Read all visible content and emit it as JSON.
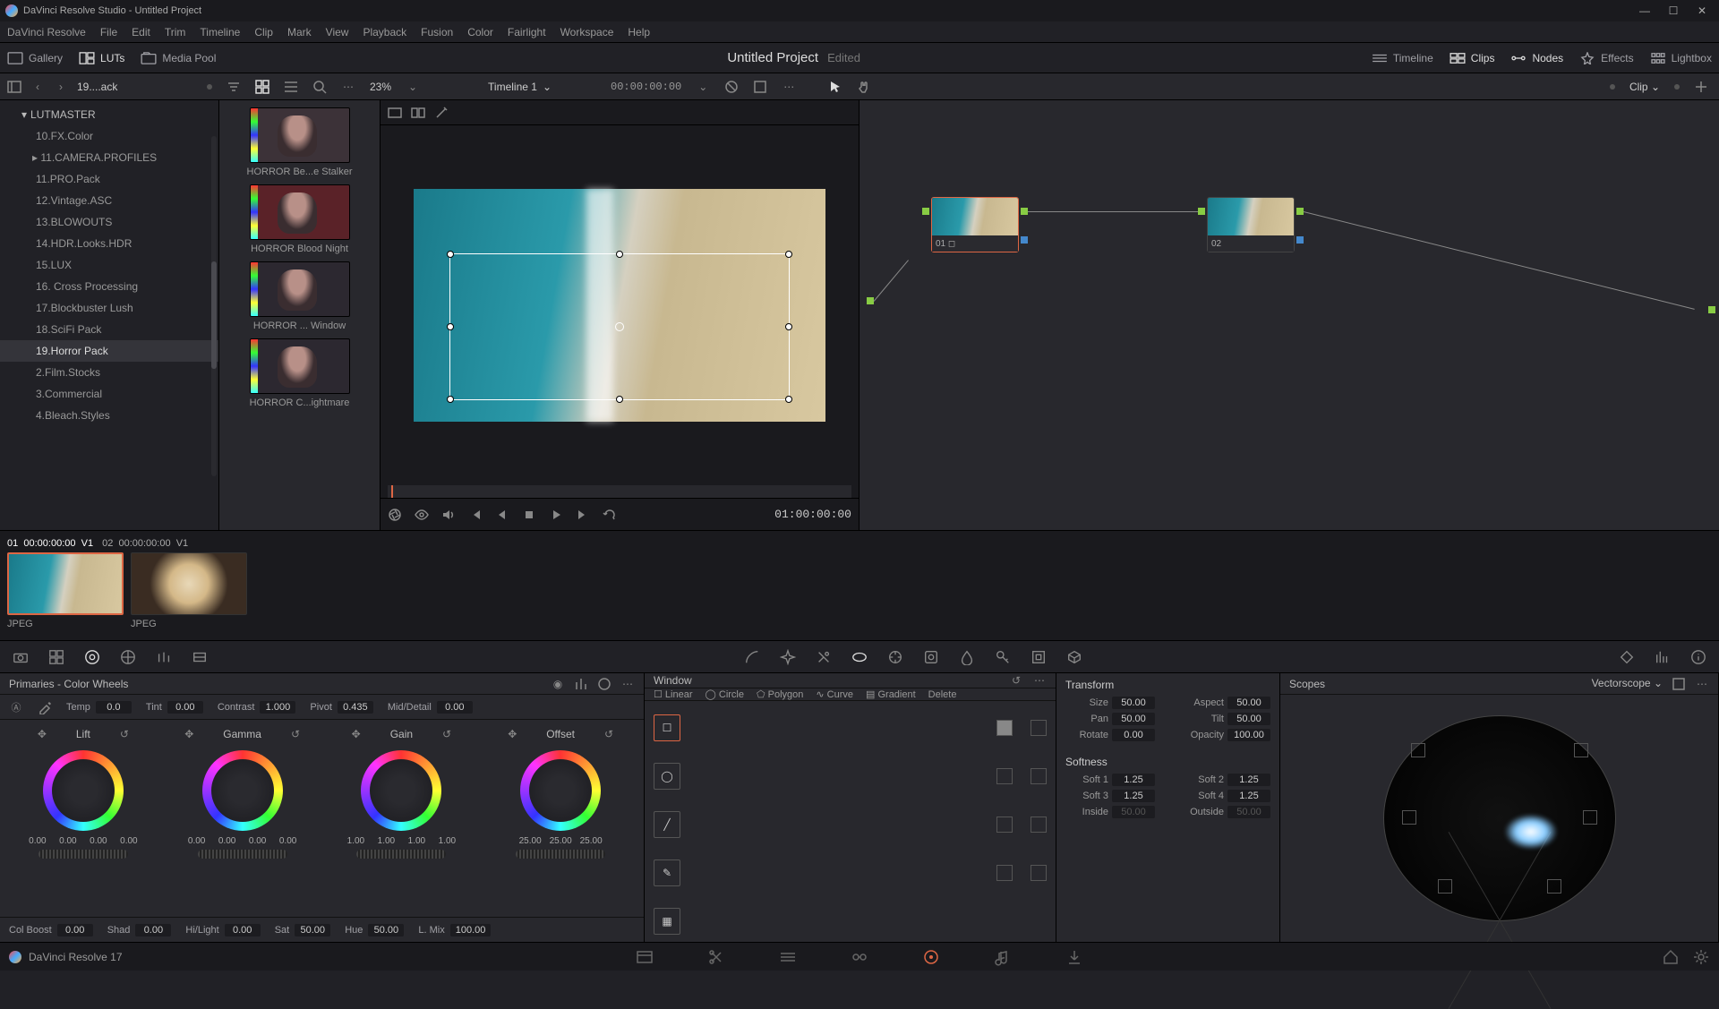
{
  "titlebar": {
    "text": "DaVinci Resolve Studio - Untitled Project"
  },
  "menubar": [
    "DaVinci Resolve",
    "File",
    "Edit",
    "Trim",
    "Timeline",
    "Clip",
    "Mark",
    "View",
    "Playback",
    "Fusion",
    "Color",
    "Fairlight",
    "Workspace",
    "Help"
  ],
  "topbar": {
    "left": [
      {
        "icon": "gallery-icon",
        "label": "Gallery"
      },
      {
        "icon": "luts-icon",
        "label": "LUTs"
      },
      {
        "icon": "mediapool-icon",
        "label": "Media Pool"
      }
    ],
    "center": {
      "title": "Untitled Project",
      "status": "Edited"
    },
    "right": [
      {
        "icon": "timeline-icon",
        "label": "Timeline"
      },
      {
        "icon": "clips-icon",
        "label": "Clips"
      },
      {
        "icon": "nodes-icon",
        "label": "Nodes"
      },
      {
        "icon": "effects-icon",
        "label": "Effects"
      },
      {
        "icon": "lightbox-icon",
        "label": "Lightbox"
      }
    ]
  },
  "subbar": {
    "breadcrumb": "19....ack",
    "zoom": "23%",
    "timeline": "Timeline 1",
    "timecode": "00:00:00:00",
    "clip_dd": "Clip"
  },
  "folders": {
    "root": "LUTMASTER",
    "items": [
      "10.FX.Color",
      "11.CAMERA.PROFILES",
      "11.PRO.Pack",
      "12.Vintage.ASC",
      "13.BLOWOUTS",
      "14.HDR.Looks.HDR",
      "15.LUX",
      "16. Cross Processing",
      "17.Blockbuster Lush",
      "18.SciFi Pack",
      "19.Horror Pack",
      "2.Film.Stocks",
      "3.Commercial",
      "4.Bleach.Styles"
    ],
    "expanded": 1,
    "selected": 10
  },
  "luts": [
    {
      "label": "HORROR Be...e Stalker",
      "tone": "red"
    },
    {
      "label": "HORROR Blood Night",
      "tone": "red"
    },
    {
      "label": "HORROR ... Window",
      "tone": "dark"
    },
    {
      "label": "HORROR C...ightmare",
      "tone": "dark"
    }
  ],
  "viewer": {
    "playhead_tc": "01:00:00:00"
  },
  "nodes": [
    {
      "id": "01",
      "selected": true
    },
    {
      "id": "02",
      "selected": false
    }
  ],
  "clips": {
    "hdr": [
      {
        "idx": "01",
        "tc": "00:00:00:00",
        "trk": "V1",
        "sel": true
      },
      {
        "idx": "02",
        "tc": "00:00:00:00",
        "trk": "V1",
        "sel": false
      }
    ],
    "labels": [
      "JPEG",
      "JPEG"
    ]
  },
  "primaries": {
    "title": "Primaries - Color Wheels",
    "adjust": {
      "temp_lbl": "Temp",
      "temp": "0.0",
      "tint_lbl": "Tint",
      "tint": "0.00",
      "contrast_lbl": "Contrast",
      "contrast": "1.000",
      "pivot_lbl": "Pivot",
      "pivot": "0.435",
      "mid_lbl": "Mid/Detail",
      "mid": "0.00"
    },
    "wheels": [
      {
        "name": "Lift",
        "vals": [
          "0.00",
          "0.00",
          "0.00",
          "0.00"
        ]
      },
      {
        "name": "Gamma",
        "vals": [
          "0.00",
          "0.00",
          "0.00",
          "0.00"
        ]
      },
      {
        "name": "Gain",
        "vals": [
          "1.00",
          "1.00",
          "1.00",
          "1.00"
        ]
      },
      {
        "name": "Offset",
        "vals": [
          "25.00",
          "25.00",
          "25.00"
        ]
      }
    ],
    "footer": {
      "cb_lbl": "Col Boost",
      "cb": "0.00",
      "shad_lbl": "Shad",
      "shad": "0.00",
      "hl_lbl": "Hi/Light",
      "hl": "0.00",
      "sat_lbl": "Sat",
      "sat": "50.00",
      "hue_lbl": "Hue",
      "hue": "50.00",
      "lmix_lbl": "L. Mix",
      "lmix": "100.00"
    }
  },
  "window": {
    "title": "Window",
    "tabs": [
      "Linear",
      "Circle",
      "Polygon",
      "Curve",
      "Gradient",
      "Delete"
    ]
  },
  "transform": {
    "t1": "Transform",
    "size_lbl": "Size",
    "size": "50.00",
    "aspect_lbl": "Aspect",
    "aspect": "50.00",
    "pan_lbl": "Pan",
    "pan": "50.00",
    "tilt_lbl": "Tilt",
    "tilt": "50.00",
    "rot_lbl": "Rotate",
    "rot": "0.00",
    "op_lbl": "Opacity",
    "op": "100.00",
    "t2": "Softness",
    "s1_lbl": "Soft 1",
    "s1": "1.25",
    "s2_lbl": "Soft 2",
    "s2": "1.25",
    "s3_lbl": "Soft 3",
    "s3": "1.25",
    "s4_lbl": "Soft 4",
    "s4": "1.25",
    "in_lbl": "Inside",
    "in": "50.00",
    "out_lbl": "Outside",
    "out": "50.00"
  },
  "scopes": {
    "title": "Scopes",
    "dd": "Vectorscope"
  },
  "footer": {
    "app": "DaVinci Resolve 17"
  }
}
